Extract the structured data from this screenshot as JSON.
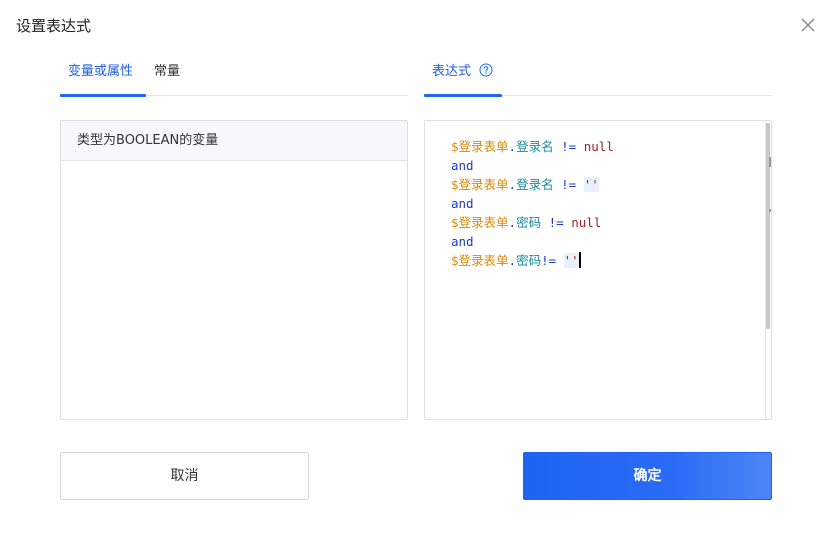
{
  "dialog": {
    "title": "设置表达式",
    "close_icon": "close-icon"
  },
  "left_tabs": [
    {
      "label": "变量或属性",
      "active": true
    },
    {
      "label": "常量",
      "active": false
    }
  ],
  "right_tabs": [
    {
      "label": "表达式",
      "active": true,
      "icon": "help-circle-icon"
    }
  ],
  "variables_panel": {
    "header": "类型为BOOLEAN的变量",
    "items": []
  },
  "expression": {
    "lines": [
      [
        {
          "t": "var",
          "v": "$登录表单"
        },
        {
          "t": "op",
          "v": "."
        },
        {
          "t": "prop",
          "v": "登录名"
        },
        {
          "t": "op",
          "v": " != "
        },
        {
          "t": "null",
          "v": "null"
        }
      ],
      [
        {
          "t": "and",
          "v": "and"
        }
      ],
      [
        {
          "t": "var",
          "v": "$登录表单"
        },
        {
          "t": "op",
          "v": "."
        },
        {
          "t": "prop",
          "v": "登录名"
        },
        {
          "t": "op",
          "v": " != "
        },
        {
          "t": "str",
          "v": "''"
        }
      ],
      [
        {
          "t": "and",
          "v": "and"
        }
      ],
      [
        {
          "t": "var",
          "v": "$登录表单"
        },
        {
          "t": "op",
          "v": "."
        },
        {
          "t": "prop",
          "v": "密码"
        },
        {
          "t": "op",
          "v": " != "
        },
        {
          "t": "null",
          "v": "null"
        }
      ],
      [
        {
          "t": "and",
          "v": "and"
        }
      ],
      [
        {
          "t": "var",
          "v": "$登录表单"
        },
        {
          "t": "op",
          "v": "."
        },
        {
          "t": "prop",
          "v": "密码"
        },
        {
          "t": "op",
          "v": "!= "
        },
        {
          "t": "str",
          "v": "''"
        }
      ]
    ]
  },
  "footer": {
    "cancel_label": "取消",
    "confirm_label": "确定"
  },
  "colors": {
    "primary": "#1f66f2",
    "variable": "#d78b07",
    "property": "#1a8a9a",
    "operator": "#1e3bc6",
    "literal": "#a0222e"
  }
}
